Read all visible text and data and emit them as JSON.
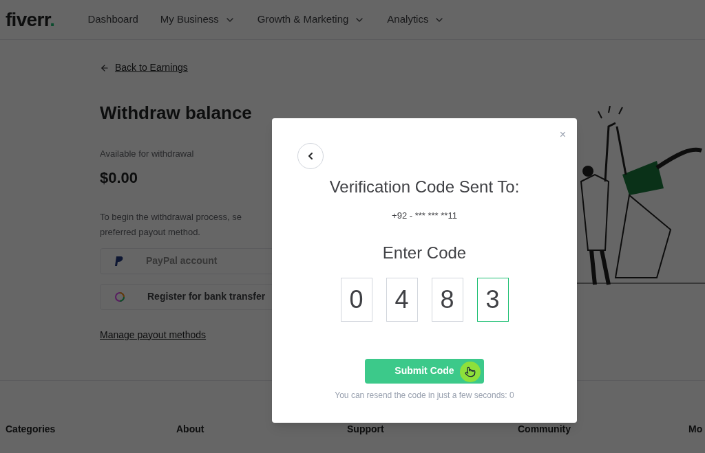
{
  "header": {
    "logo": "fiverr",
    "logo_dot": ".",
    "nav": [
      {
        "label": "Dashboard",
        "has_menu": false
      },
      {
        "label": "My Business",
        "has_menu": true
      },
      {
        "label": "Growth & Marketing",
        "has_menu": true
      },
      {
        "label": "Analytics",
        "has_menu": true
      }
    ]
  },
  "page": {
    "back_link": "Back to Earnings",
    "title": "Withdraw balance",
    "available_label": "Available for withdrawal",
    "balance": "$0.00",
    "intro": "To begin the withdrawal process, se preferred payout method.",
    "methods": [
      {
        "kind": "paypal",
        "label": "PayPal account",
        "disabled": true
      },
      {
        "kind": "bank",
        "label": "Register for bank transfer",
        "disabled": false
      }
    ],
    "manage_link": "Manage payout methods"
  },
  "footer": {
    "columns": [
      "Categories",
      "About",
      "Support",
      "Community",
      "Mo"
    ]
  },
  "modal": {
    "title": "Verification Code Sent To:",
    "phone": "+92 - *** *** **11",
    "enter_label": "Enter Code",
    "digits": [
      {
        "value": "0",
        "focused": false
      },
      {
        "value": "4",
        "focused": false
      },
      {
        "value": "8",
        "focused": false
      },
      {
        "value": "3",
        "focused": true
      }
    ],
    "submit": "Submit Code",
    "resend_note": "You can resend the code in just a few seconds: 0",
    "close": "×"
  }
}
